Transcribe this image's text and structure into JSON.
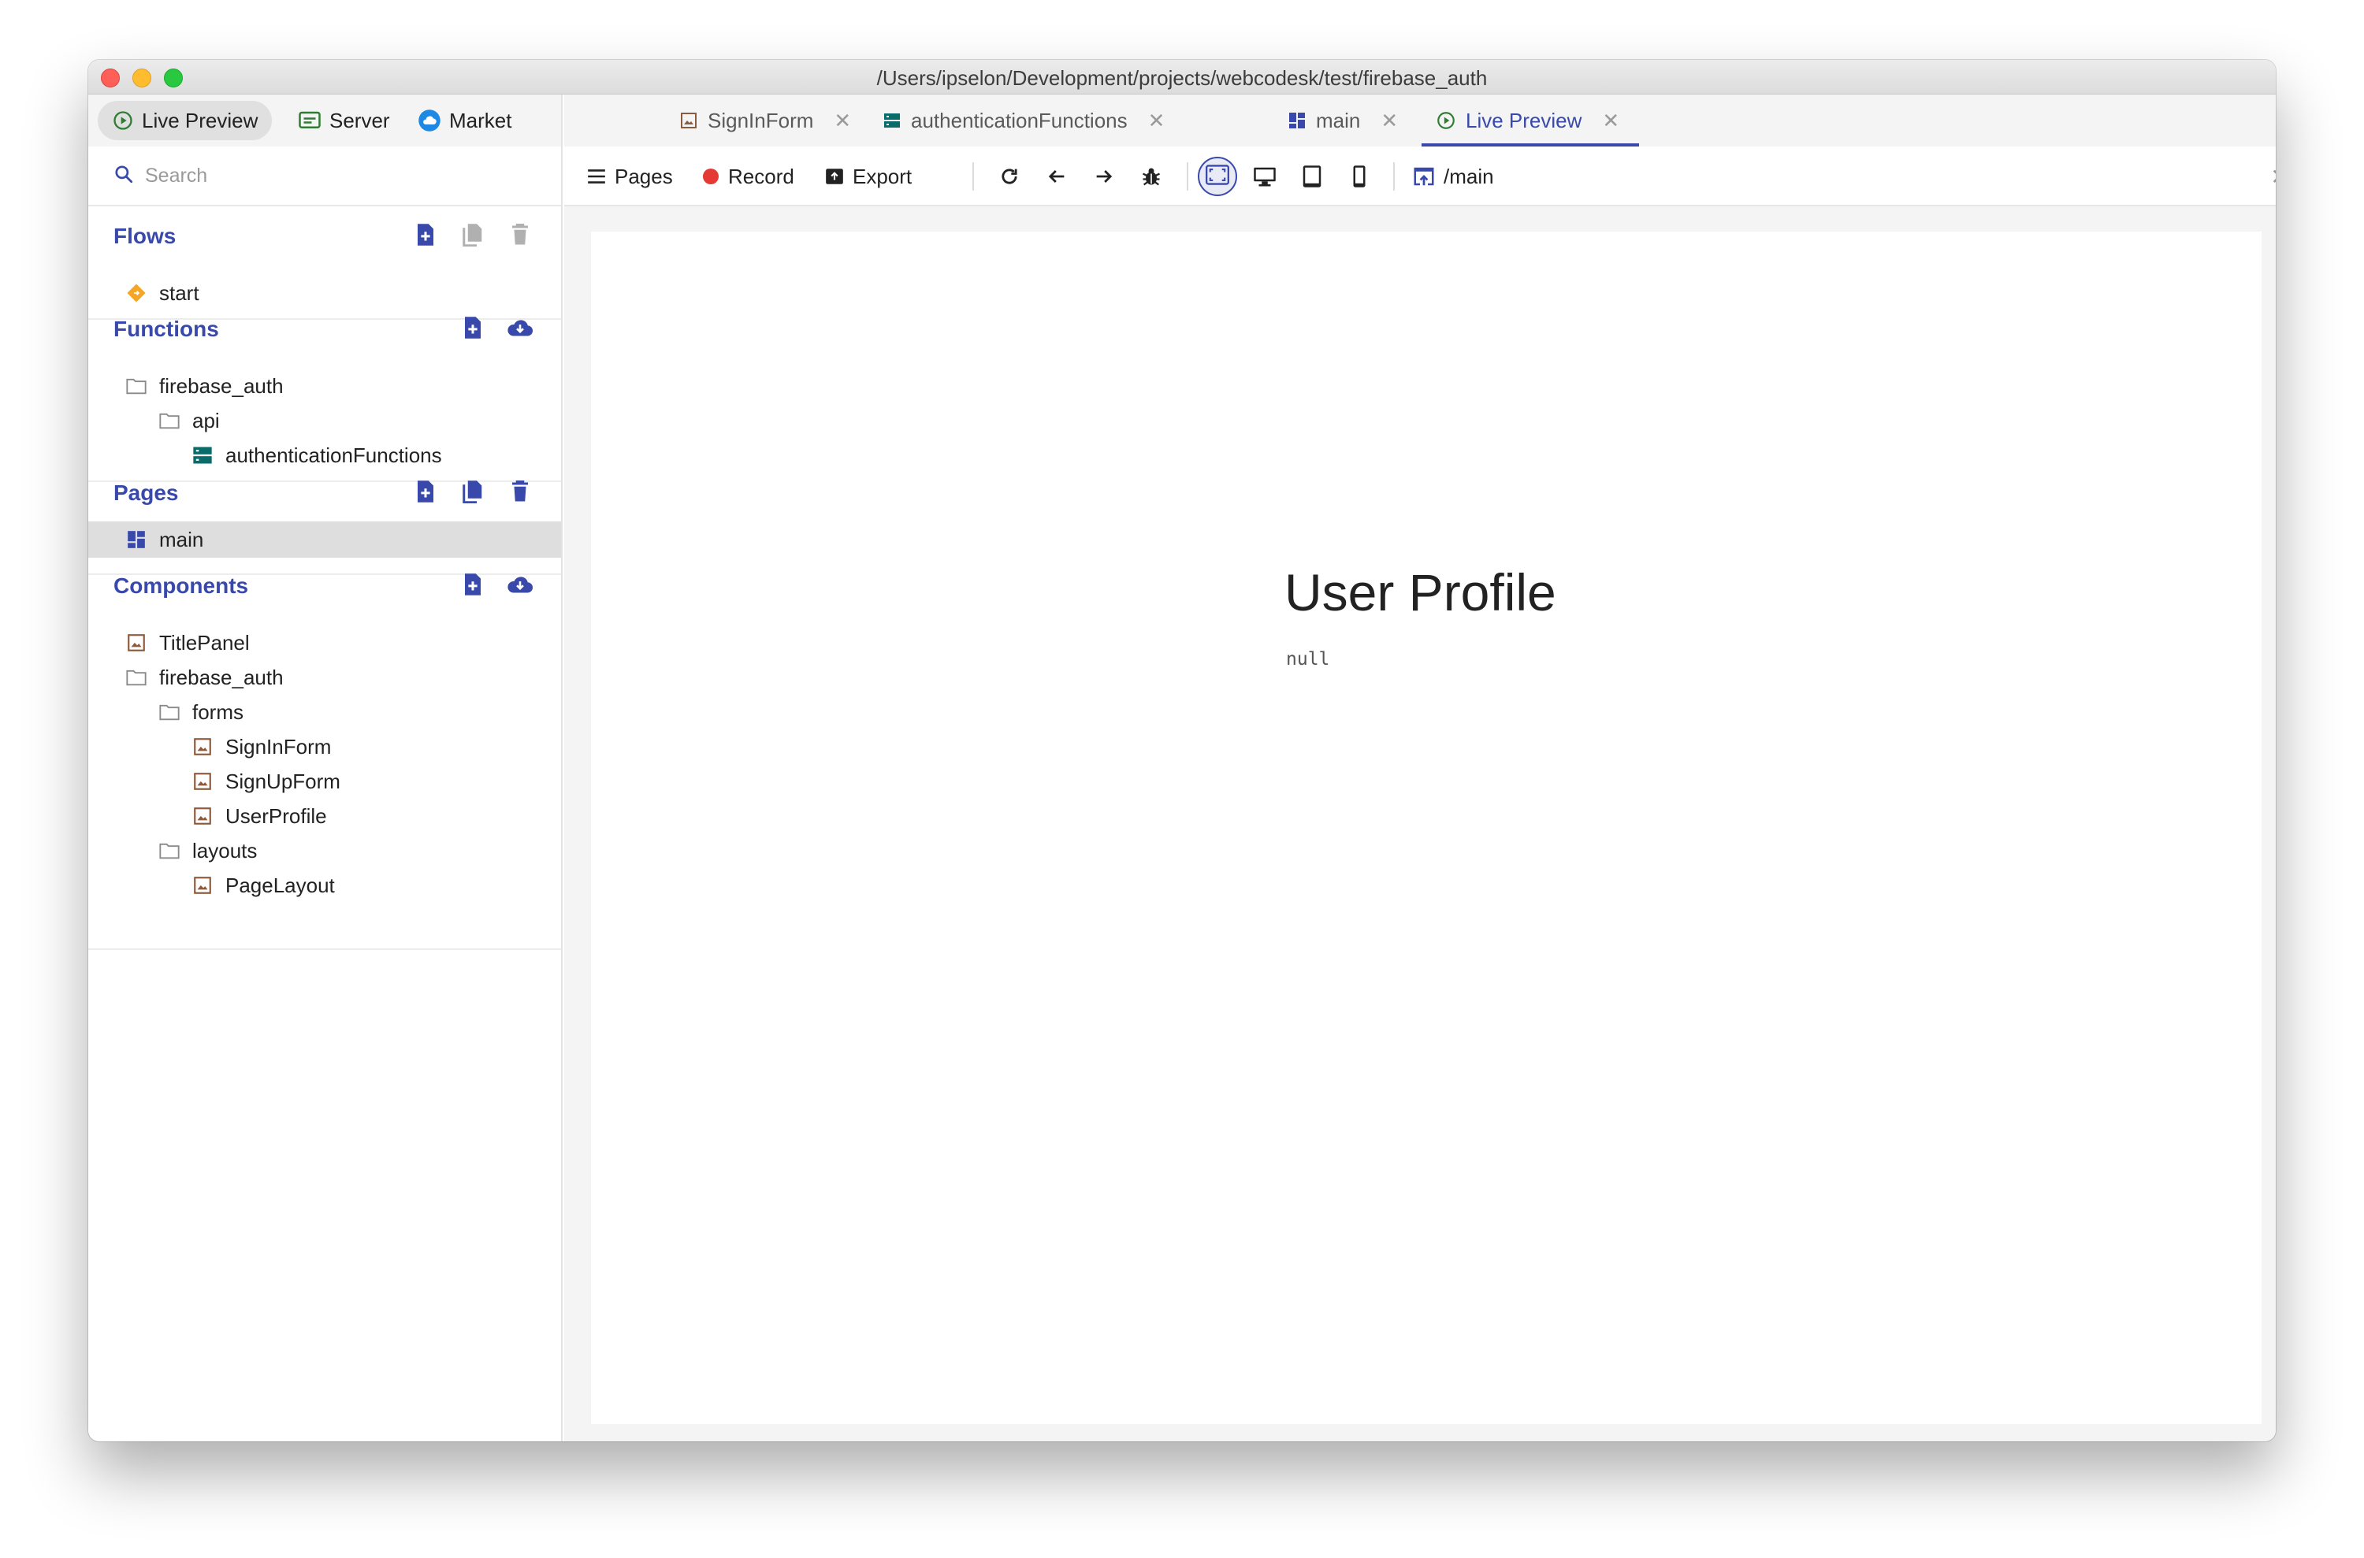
{
  "window": {
    "title": "/Users/ipselon/Development/projects/webcodesk/test/firebase_auth"
  },
  "sidebar": {
    "tabs": [
      {
        "label": "Live Preview",
        "icon": "play-circle-icon"
      },
      {
        "label": "Server",
        "icon": "server-window-icon"
      },
      {
        "label": "Market",
        "icon": "cloud-icon"
      }
    ],
    "search": {
      "placeholder": "Search"
    },
    "flows": {
      "title": "Flows",
      "items": [
        {
          "label": "start"
        }
      ]
    },
    "functions": {
      "title": "Functions",
      "items": [
        {
          "label": "firebase_auth"
        },
        {
          "label": "api"
        },
        {
          "label": "authenticationFunctions"
        }
      ]
    },
    "pages": {
      "title": "Pages",
      "items": [
        {
          "label": "main"
        }
      ]
    },
    "components": {
      "title": "Components",
      "items": [
        {
          "label": "TitlePanel"
        },
        {
          "label": "firebase_auth"
        },
        {
          "label": "forms"
        },
        {
          "label": "SignInForm"
        },
        {
          "label": "SignUpForm"
        },
        {
          "label": "UserProfile"
        },
        {
          "label": "layouts"
        },
        {
          "label": "PageLayout"
        }
      ]
    }
  },
  "editor_tabs": [
    {
      "label": "SignInForm"
    },
    {
      "label": "authenticationFunctions"
    },
    {
      "label": "main"
    },
    {
      "label": "Live Preview",
      "active": true
    }
  ],
  "toolbar": {
    "pages_label": "Pages",
    "record_label": "Record",
    "export_label": "Export",
    "path": "/main"
  },
  "preview": {
    "title": "User Profile",
    "value": "null"
  },
  "colors": {
    "accent": "#3949ab",
    "record": "#e53935",
    "component_icon": "#8d5a3c",
    "function_icon": "#0a6b6b",
    "flow_icon": "#f5a623"
  }
}
